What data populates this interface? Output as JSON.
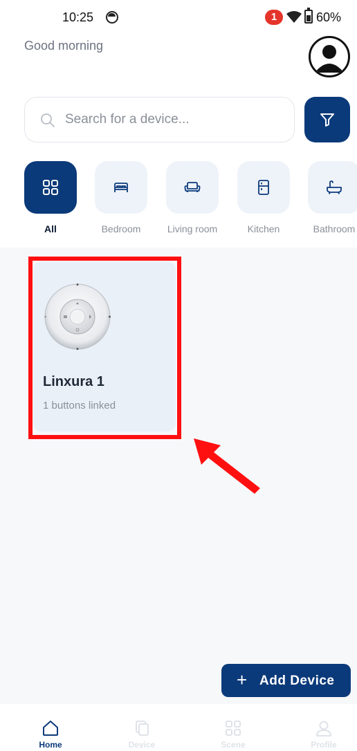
{
  "status_bar": {
    "time": "10:25",
    "notification_count": "1",
    "battery": "60%"
  },
  "header": {
    "greeting": "Good morning"
  },
  "search": {
    "placeholder": "Search for a device..."
  },
  "categories": [
    {
      "label": "All",
      "icon": "grid-icon",
      "active": true
    },
    {
      "label": "Bedroom",
      "icon": "bed-icon",
      "active": false
    },
    {
      "label": "Living room",
      "icon": "sofa-icon",
      "active": false
    },
    {
      "label": "Kitchen",
      "icon": "fridge-icon",
      "active": false
    },
    {
      "label": "Bathroom",
      "icon": "bathtub-icon",
      "active": false
    }
  ],
  "devices": [
    {
      "name": "Linxura 1",
      "subtitle": "1 buttons linked"
    }
  ],
  "add_device": {
    "label": "Add Device"
  },
  "bottom_nav": [
    {
      "label": "Home",
      "icon": "home-icon",
      "active": true
    },
    {
      "label": "Device",
      "icon": "device-icon",
      "active": false
    },
    {
      "label": "Scene",
      "icon": "scene-icon",
      "active": false
    },
    {
      "label": "Profile",
      "icon": "profile-icon",
      "active": false
    }
  ],
  "colors": {
    "primary": "#0b3a7a",
    "tile_bg": "#eef3f9",
    "card_bg": "#eaf0f7",
    "highlight": "#ff1010",
    "badge": "#e5342a"
  }
}
